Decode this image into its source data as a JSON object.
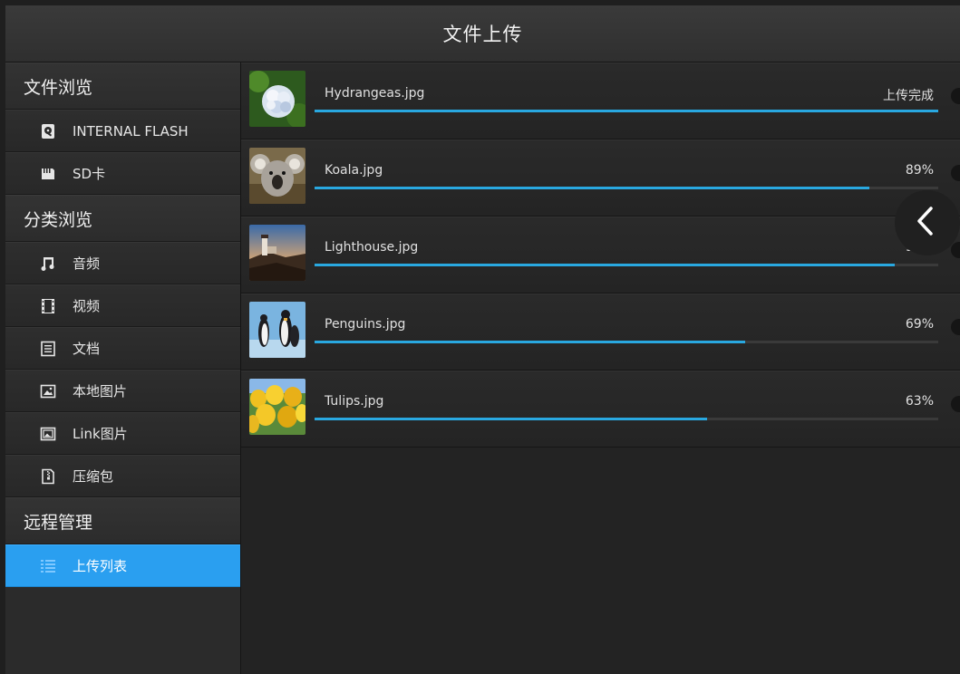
{
  "header": {
    "title": "文件上传"
  },
  "sidebar": {
    "sections": [
      {
        "title": "文件浏览",
        "items": [
          {
            "label": "INTERNAL FLASH",
            "icon": "hard-drive-icon"
          },
          {
            "label": "SD卡",
            "icon": "sd-card-icon"
          }
        ]
      },
      {
        "title": "分类浏览",
        "items": [
          {
            "label": "音频",
            "icon": "music-note-icon"
          },
          {
            "label": "视频",
            "icon": "film-icon"
          },
          {
            "label": "文档",
            "icon": "document-icon"
          },
          {
            "label": "本地图片",
            "icon": "image-icon"
          },
          {
            "label": "Link图片",
            "icon": "linked-image-icon"
          },
          {
            "label": "压缩包",
            "icon": "zip-file-icon"
          }
        ]
      },
      {
        "title": "远程管理",
        "items": [
          {
            "label": "上传列表",
            "icon": "list-icon",
            "active": true
          }
        ]
      }
    ]
  },
  "uploads": [
    {
      "name": "Hydrangeas.jpg",
      "status": "上传完成",
      "progress": 1.0,
      "thumbnail": "hydrangea-flower"
    },
    {
      "name": "Koala.jpg",
      "status": "89%",
      "progress": 0.89,
      "thumbnail": "koala"
    },
    {
      "name": "Lighthouse.jpg",
      "status": "93%",
      "progress": 0.93,
      "thumbnail": "lighthouse"
    },
    {
      "name": "Penguins.jpg",
      "status": "69%",
      "progress": 0.69,
      "thumbnail": "penguins"
    },
    {
      "name": "Tulips.jpg",
      "status": "63%",
      "progress": 0.63,
      "thumbnail": "tulips"
    }
  ],
  "back_button": {
    "icon": "chevron-left-icon"
  },
  "colors": {
    "accent": "#2a9ff0",
    "progress": "#29a8e0"
  }
}
